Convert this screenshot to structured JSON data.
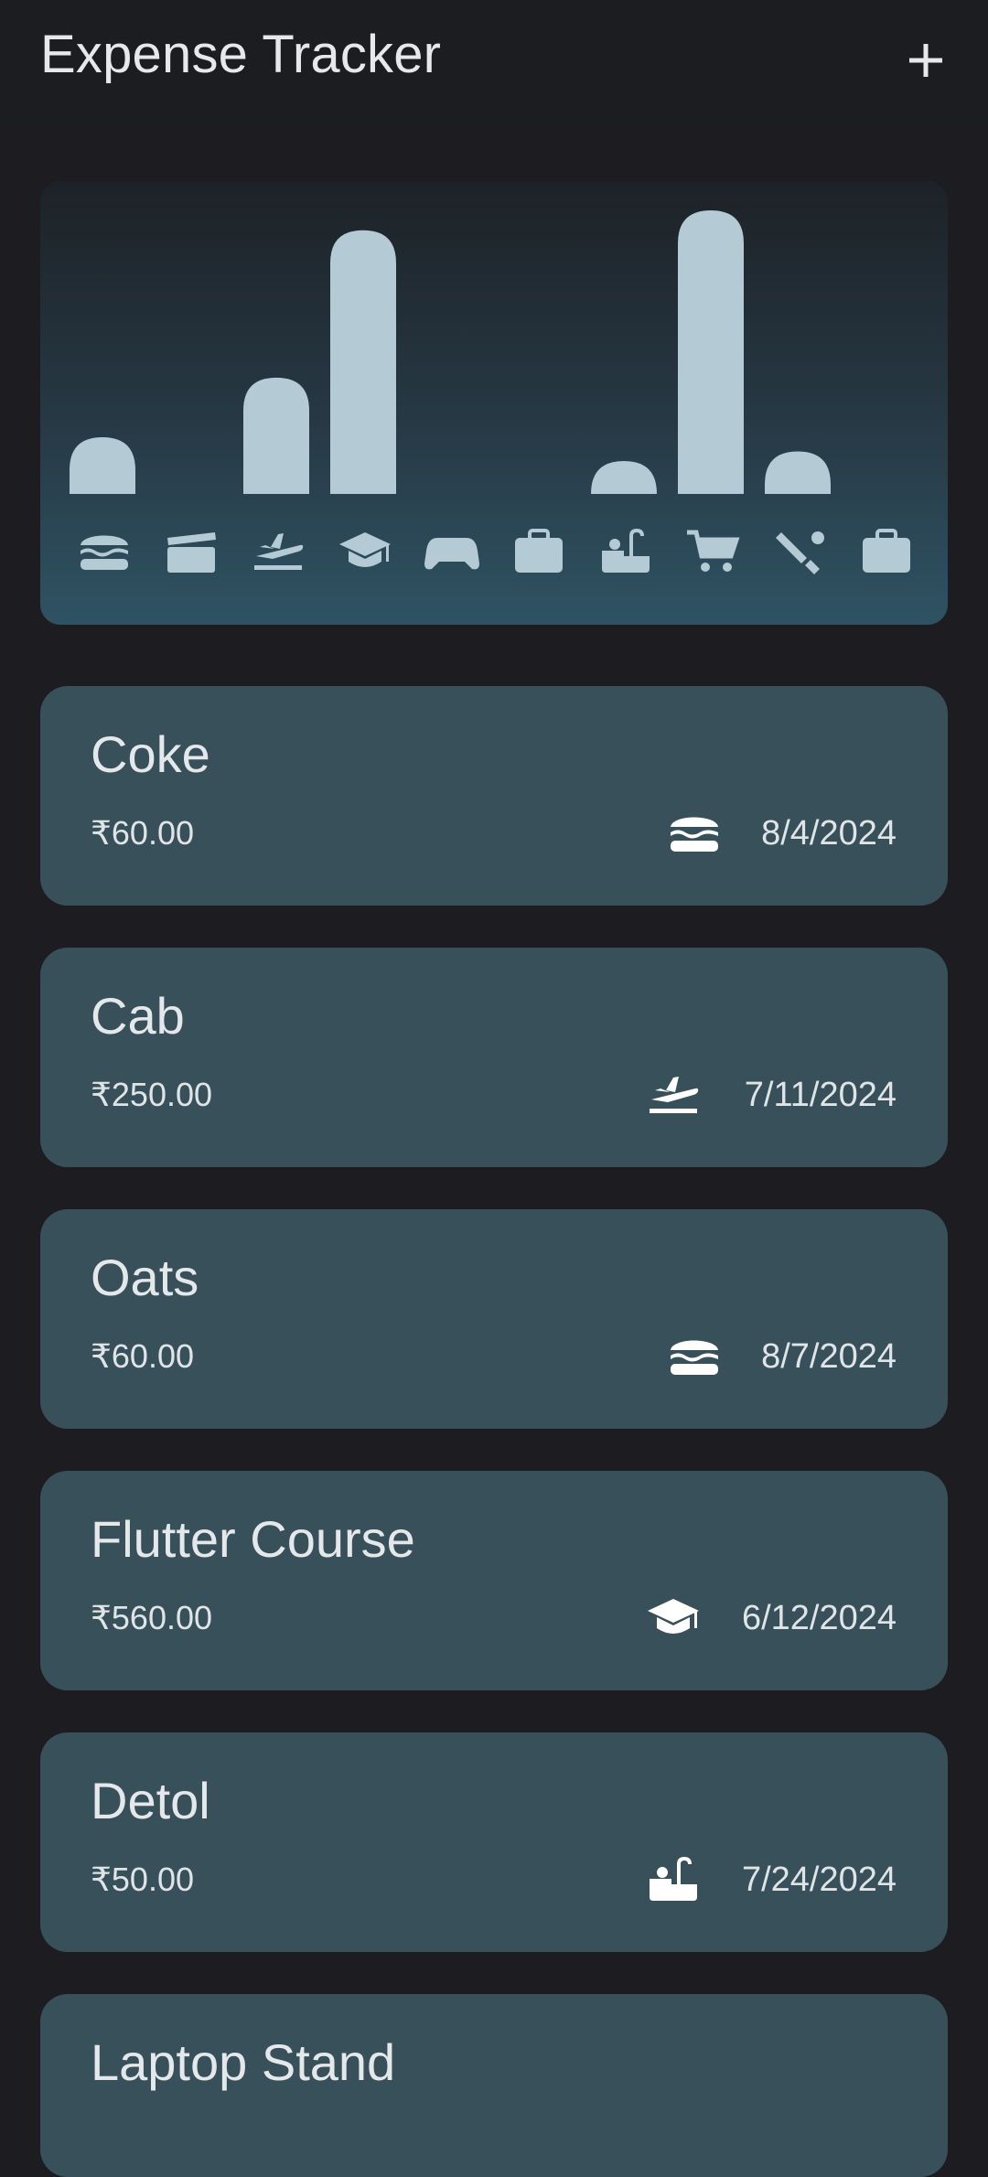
{
  "app": {
    "title": "Expense Tracker"
  },
  "chart_data": {
    "type": "bar",
    "categories": [
      "food",
      "movie",
      "travel",
      "education",
      "gaming",
      "medical",
      "personal-care",
      "shopping",
      "sports",
      "work"
    ],
    "values": [
      0.2,
      0,
      0.41,
      0.93,
      0,
      0,
      0.08,
      1.0,
      0.15,
      0
    ],
    "ylim": [
      0,
      1
    ]
  },
  "expenses": [
    {
      "title": "Coke",
      "amount": "₹60.00",
      "date": "8/4/2024",
      "category_icon": "burger-icon"
    },
    {
      "title": "Cab",
      "amount": "₹250.00",
      "date": "7/11/2024",
      "category_icon": "flight-takeoff-icon"
    },
    {
      "title": "Oats",
      "amount": "₹60.00",
      "date": "8/7/2024",
      "category_icon": "burger-icon"
    },
    {
      "title": "Flutter Course",
      "amount": "₹560.00",
      "date": "6/12/2024",
      "category_icon": "graduation-cap-icon"
    },
    {
      "title": "Detol",
      "amount": "₹50.00",
      "date": "7/24/2024",
      "category_icon": "bathtub-icon"
    },
    {
      "title": "Laptop Stand",
      "amount": "",
      "date": "",
      "category_icon": ""
    }
  ],
  "colors": {
    "bar": "#b4cad5",
    "card": "#38505a",
    "background": "#1d1c21"
  }
}
